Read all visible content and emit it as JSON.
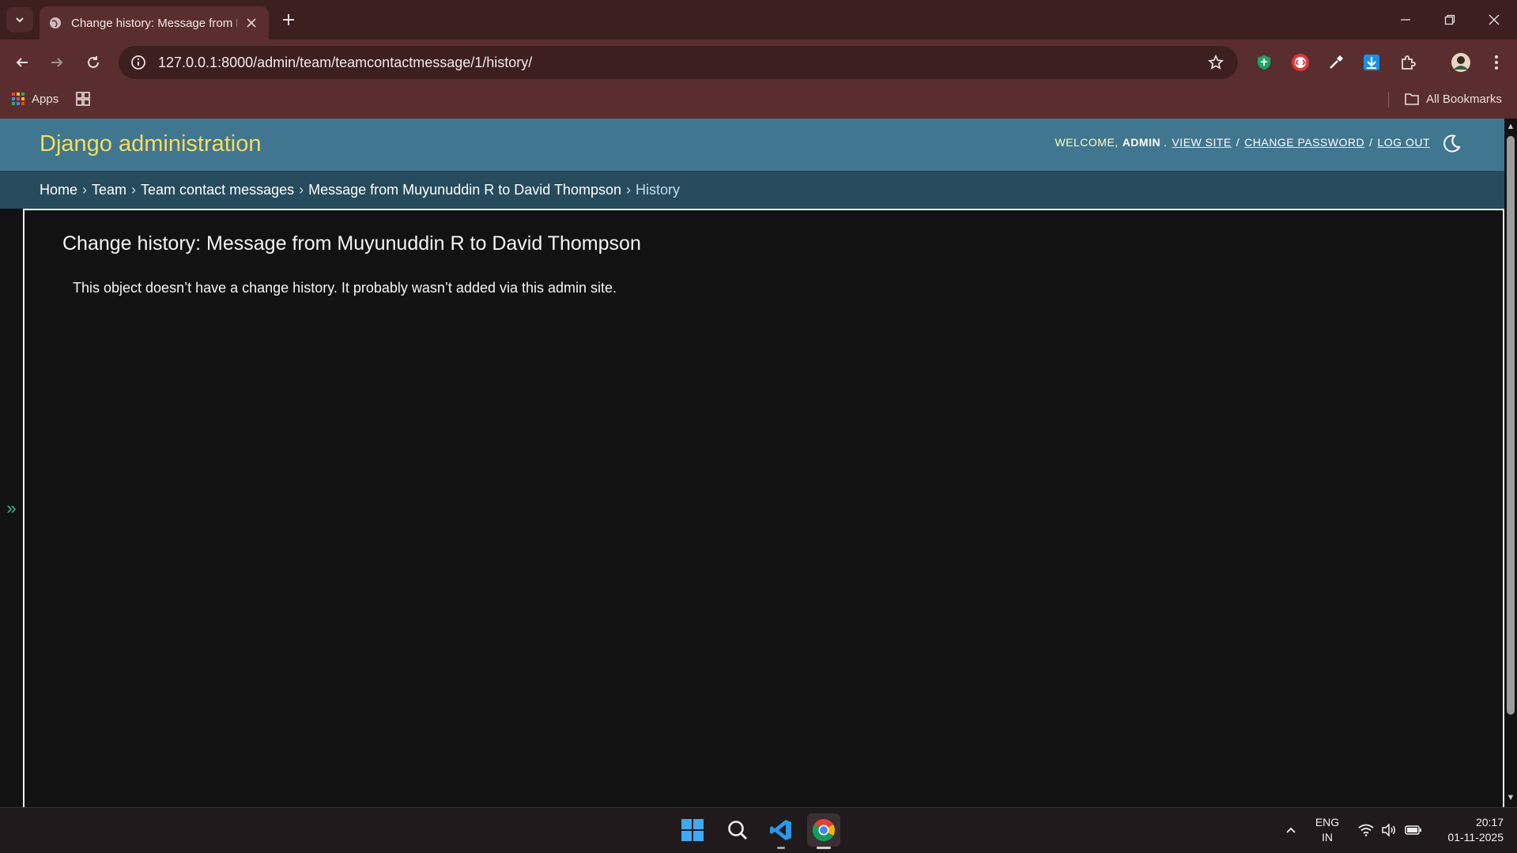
{
  "browser": {
    "tab_title": "Change history: Message from Muyunuddin R to David Thompson",
    "url": "127.0.0.1:8000/admin/team/teamcontactmessage/1/history/",
    "bookmarks_apps_label": "Apps",
    "bookmarks_all_label": "All Bookmarks"
  },
  "header": {
    "branding": "Django administration",
    "welcome_label": "WELCOME,",
    "username": "ADMIN",
    "view_site": "VIEW SITE",
    "change_password": "CHANGE PASSWORD",
    "log_out": "LOG OUT",
    "separator": "/"
  },
  "breadcrumbs": {
    "items": [
      "Home",
      "Team",
      "Team contact messages",
      "Message from Muyunuddin R to David Thompson"
    ],
    "current": "History",
    "separator": "›"
  },
  "sidebar": {
    "toggle_glyph": "»"
  },
  "content": {
    "title": "Change history: Message from Muyunuddin R to David Thompson",
    "message": "This object doesn’t have a change history. It probably wasn’t added via this admin site."
  },
  "taskbar": {
    "lang_line1": "ENG",
    "lang_line2": "IN",
    "time": "20:17",
    "date": "01-11-2025"
  },
  "colors": {
    "header_bg": "#417690",
    "branding": "#f5dd5d",
    "breadcrumbs_bg": "#264b5d",
    "browser_frame": "#5a2e2e",
    "content_bg": "#121212"
  }
}
